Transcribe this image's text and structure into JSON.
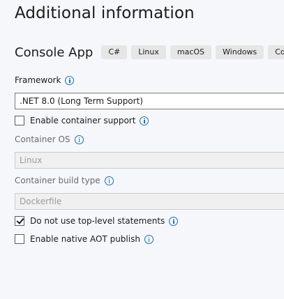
{
  "page": {
    "title": "Additional information"
  },
  "template": {
    "name": "Console App",
    "tags": [
      "C#",
      "Linux",
      "macOS",
      "Windows",
      "Cons"
    ]
  },
  "framework": {
    "label": "Framework",
    "value": ".NET 8.0 (Long Term Support)"
  },
  "container_support": {
    "label": "Enable container support",
    "checked": false
  },
  "container_os": {
    "label": "Container OS",
    "value": "Linux",
    "disabled": true
  },
  "container_build_type": {
    "label": "Container build type",
    "value": "Dockerfile",
    "disabled": true
  },
  "top_level_statements": {
    "label": "Do not use top-level statements",
    "checked": true
  },
  "native_aot": {
    "label": "Enable native AOT publish",
    "checked": false
  },
  "icons": {
    "info": "info-circle-icon",
    "checkmark": "checkmark-icon"
  },
  "colors": {
    "info_icon": "#1a6fb0",
    "background": "#f6f7fb",
    "disabled_text": "#9a9a9a"
  }
}
